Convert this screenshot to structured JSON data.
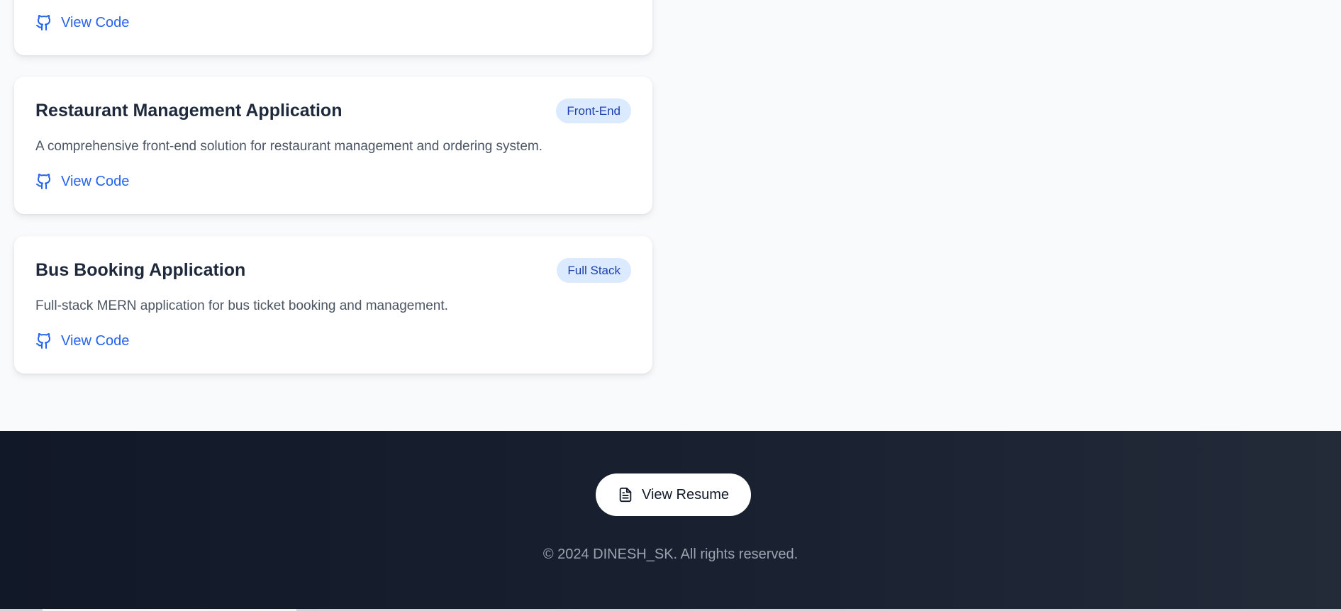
{
  "projects": [
    {
      "link_label": "View Code"
    },
    {
      "title": "Restaurant Management Application",
      "badge": "Front-End",
      "description": "A comprehensive front-end solution for restaurant management and ordering system.",
      "link_label": "View Code",
      "link_icon": "github-icon"
    },
    {
      "title": "Bus Booking Application",
      "badge": "Full Stack",
      "description": "Full-stack MERN application for bus ticket booking and management.",
      "link_label": "View Code",
      "link_icon": "github-icon"
    }
  ],
  "footer": {
    "resume_label": "View Resume",
    "resume_icon": "file-text-icon",
    "copyright": "© 2024 DINESH_SK. All rights reserved."
  },
  "colors": {
    "accent": "#2563eb",
    "badge_bg": "#dbeafe",
    "badge_text": "#1e40af",
    "footer_bg": "#111827",
    "page_bg": "#f8fafc"
  }
}
